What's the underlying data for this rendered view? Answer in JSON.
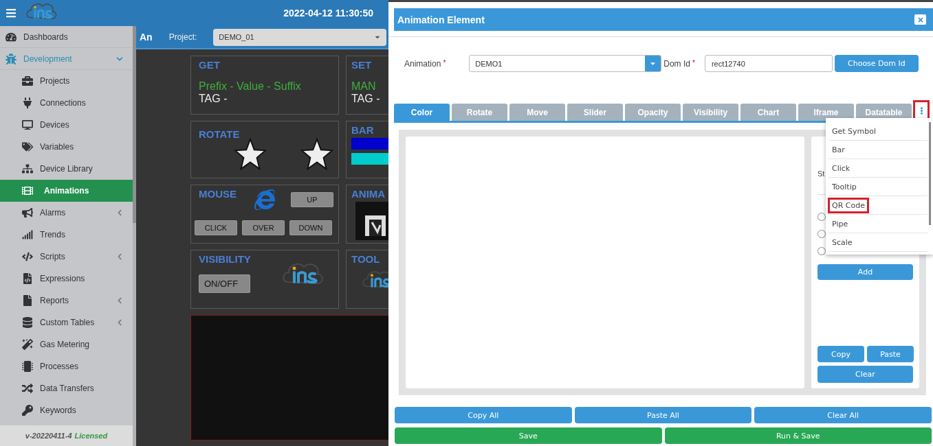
{
  "topbar": {
    "datetime": "2022-04-12 11:30:50"
  },
  "sidebar": {
    "items": [
      {
        "label": "Dashboards",
        "selected": false
      },
      {
        "label": "Development",
        "selected": false,
        "expanded": true,
        "children": [
          {
            "label": "Projects",
            "selected": false
          },
          {
            "label": "Connections",
            "selected": false
          },
          {
            "label": "Devices",
            "selected": false
          },
          {
            "label": "Variables",
            "selected": false
          },
          {
            "label": "Device Library",
            "selected": false
          },
          {
            "label": "Animations",
            "selected": true
          },
          {
            "label": "Alarms",
            "selected": false,
            "expanded": false
          },
          {
            "label": "Trends",
            "selected": false
          },
          {
            "label": "Scripts",
            "selected": false,
            "expanded": false
          },
          {
            "label": "Expressions",
            "selected": false
          },
          {
            "label": "Reports",
            "selected": false,
            "expanded": false
          },
          {
            "label": "Custom Tables",
            "selected": false,
            "expanded": false
          },
          {
            "label": "Gas Metering",
            "selected": false
          },
          {
            "label": "Processes",
            "selected": false
          },
          {
            "label": "Data Transfers",
            "selected": false
          },
          {
            "label": "Keywords",
            "selected": false
          }
        ]
      }
    ],
    "footer": {
      "version": "v-20220411-4",
      "license": "Licensed"
    }
  },
  "content": {
    "title": "An",
    "project_label": "Project:",
    "project": "DEMO_01",
    "tiles": [
      {
        "kind": "text",
        "title": "GET",
        "value": "Prefix - Value - Suffix",
        "tag": "TAG -"
      },
      {
        "kind": "text",
        "title": "SET",
        "value": "MAN",
        "tag": "TAG -"
      },
      {
        "kind": "rotate",
        "title": "ROTATE"
      },
      {
        "kind": "bar",
        "title": "BAR"
      },
      {
        "kind": "mouse",
        "title": "MOUSE",
        "buttons": [
          "UP",
          "CLICK",
          "OVER",
          "DOWN"
        ]
      },
      {
        "kind": "picture",
        "title": "ANIMA"
      },
      {
        "kind": "visibility",
        "title": "VISIBILITY",
        "button": "ON/OFF"
      },
      {
        "kind": "logo",
        "title": "TOOL"
      }
    ]
  },
  "modal": {
    "title": "Animation Element",
    "fields": [
      {
        "kind": "select",
        "label": "Animation",
        "mark": "*",
        "value": "DEMO1"
      },
      {
        "kind": "text",
        "label": "Dom Id",
        "mark": "*",
        "value": "rect12740"
      }
    ],
    "choose_button": "Choose Dom Id",
    "tabs": [
      {
        "label": "Color",
        "selected": true
      },
      {
        "label": "Rotate",
        "selected": false
      },
      {
        "label": "Move",
        "selected": false
      },
      {
        "label": "Slider",
        "selected": false
      },
      {
        "label": "Opacity",
        "selected": false
      },
      {
        "label": "Visibility",
        "selected": false
      },
      {
        "label": "Chart",
        "selected": false
      },
      {
        "label": "Iframe",
        "selected": false
      },
      {
        "label": "Datatable",
        "selected": false
      }
    ],
    "more_button": {
      "highlighted": true
    },
    "menu": [
      {
        "label": "Get Symbol",
        "highlighted": false
      },
      {
        "label": "Bar",
        "highlighted": false
      },
      {
        "label": "Click",
        "highlighted": false
      },
      {
        "label": "Tooltip",
        "highlighted": false
      },
      {
        "label": "QR Code",
        "highlighted": true
      },
      {
        "label": "Pipe",
        "highlighted": false
      },
      {
        "label": "Scale",
        "highlighted": false
      }
    ],
    "side_panel": {
      "label": "St",
      "radios": [
        {
          "selected": false
        },
        {
          "selected": false
        },
        {
          "selected": false
        }
      ],
      "add": "Add",
      "copy": "Copy",
      "paste": "Paste",
      "clear": "Clear"
    },
    "footer_rows": [
      [
        {
          "label": "Copy All",
          "kind": "primary"
        },
        {
          "label": "Paste All",
          "kind": "primary"
        },
        {
          "label": "Clear All",
          "kind": "primary"
        }
      ],
      [
        {
          "label": "Save",
          "kind": "success"
        },
        {
          "label": "Run & Save",
          "kind": "success"
        }
      ]
    ]
  }
}
